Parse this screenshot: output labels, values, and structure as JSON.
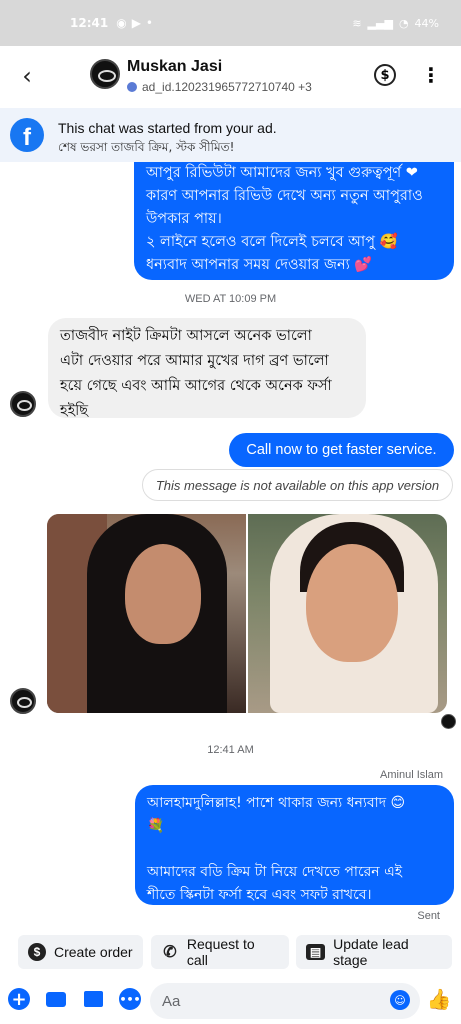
{
  "status_bar": {
    "time": "12:41",
    "battery": "44%",
    "icons": [
      "messenger-icon",
      "youtube-icon",
      "dot-icon",
      "signal-icon",
      "wifi-icon",
      "battery-icon"
    ]
  },
  "header": {
    "name": "Muskan Jasi",
    "ad_id": "ad_id.120231965772710740 +3"
  },
  "ad_banner": {
    "title": "This chat was started from your ad.",
    "subtitle": "শেষ ভরসা তাজবি ক্রিম, স্টক সীমিত!"
  },
  "messages": {
    "m1_lines": [
      "আপুর রিভিউটা আমাদের জন্য খুব গুরুত্বপূর্ণ ❤",
      "কারণ আপনার রিভিউ দেখে অন্য নতুন আপুরাও",
      "উপকার পায়।",
      "২ লাইনে হলেও বলে দিলেই চলবে আপু 🥰",
      "ধন্যবাদ আপনার সময় দেওয়ার জন্য 💕"
    ],
    "timestamp1": "WED AT 10:09 PM",
    "m2_lines": [
      "তাজবীদ  নাইট ক্রিমটা আসলে অনেক ভালো",
      "এটা দেওয়ার পরে আমার মুখের দাগ ব্রণ ভালো",
      "হয়ে গেছে এবং আমি আগের থেকে অনেক ফর্সা",
      "হইছি"
    ],
    "m3": "Call now to get faster service.",
    "unavailable": "This message is not available on this app version",
    "timestamp2": "12:41 AM",
    "sender_name": "Aminul Islam",
    "m4_lines": [
      "আলহামদুলিল্লাহ!  পাশে থাকার জন্য ধন্যবাদ 😊",
      "💐",
      "",
      "আমাদের বডি ক্রিম টা নিয়ে দেখতে পারেন এই",
      "শীতে স্কিনটা ফর্সা হবে এবং সফট রাখবে।"
    ],
    "status": "Sent"
  },
  "actions": {
    "create_order": "Create order",
    "request_call": "Request to call",
    "update_lead": "Update lead stage"
  },
  "composer": {
    "placeholder": "Aa"
  },
  "colors": {
    "accent": "#0866ff",
    "incoming_bubble": "#f0f0f0",
    "banner_bg": "#eef3fb"
  }
}
